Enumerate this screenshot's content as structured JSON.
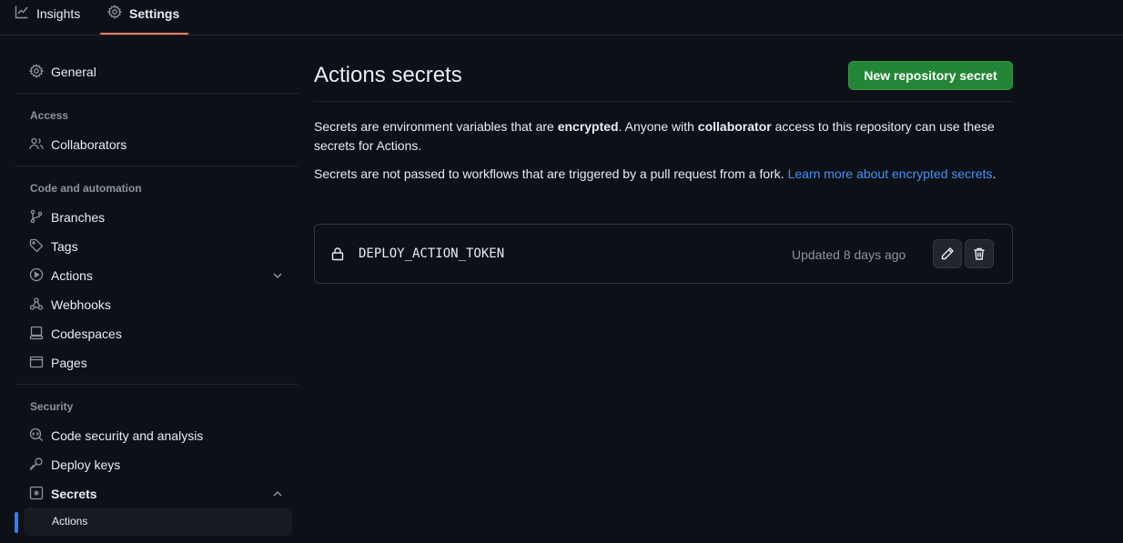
{
  "topnav": {
    "tabs": [
      {
        "label": "Insights",
        "icon": "graph-icon"
      },
      {
        "label": "Settings",
        "icon": "gear-icon",
        "selected": true
      }
    ]
  },
  "sidebar": {
    "general": "General",
    "access_heading": "Access",
    "collaborators": "Collaborators",
    "code_automation_heading": "Code and automation",
    "branches": "Branches",
    "tags": "Tags",
    "actions": "Actions",
    "webhooks": "Webhooks",
    "codespaces": "Codespaces",
    "pages": "Pages",
    "security_heading": "Security",
    "code_security": "Code security and analysis",
    "deploy_keys": "Deploy keys",
    "secrets": "Secrets",
    "secrets_sub_actions": "Actions"
  },
  "main": {
    "title": "Actions secrets",
    "new_button": "New repository secret",
    "para1": {
      "t1": "Secrets are environment variables that are ",
      "b1": "encrypted",
      "t2": ". Anyone with ",
      "b2": "collaborator",
      "t3": " access to this repository can use these secrets for Actions."
    },
    "para2": {
      "t1": "Secrets are not passed to workflows that are triggered by a pull request from a fork. ",
      "link": "Learn more about encrypted secrets",
      "t2": "."
    },
    "secrets": [
      {
        "name": "DEPLOY_ACTION_TOKEN",
        "updated": "Updated 8 days ago"
      }
    ]
  },
  "colors": {
    "background": "#0d1117",
    "accent_green": "#238636",
    "link_blue": "#4493f8",
    "tab_underline": "#f78166",
    "active_bar": "#2f81f7"
  }
}
